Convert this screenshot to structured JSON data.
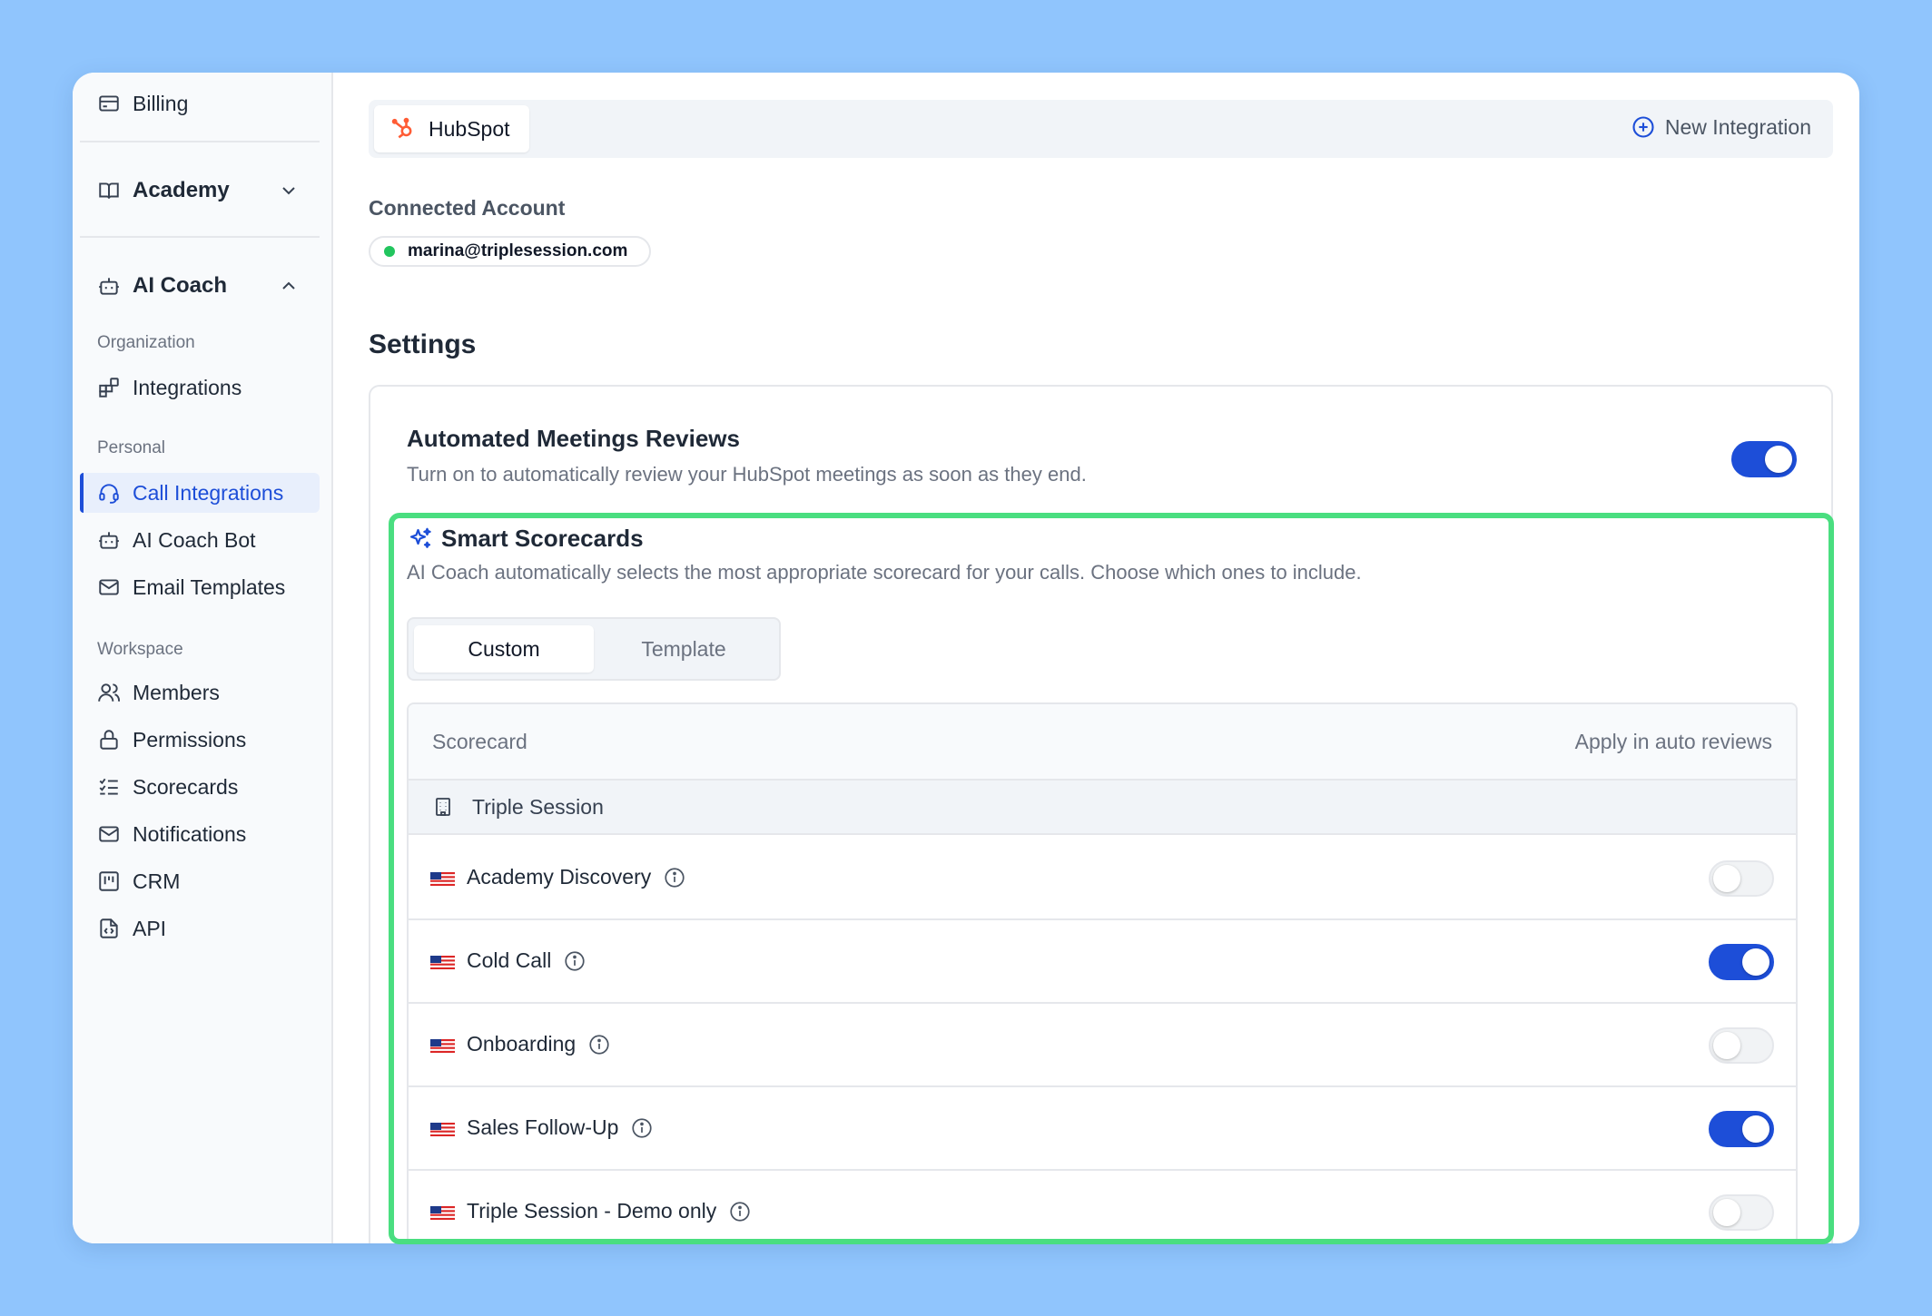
{
  "sidebar": {
    "billing": "Billing",
    "academy": "Academy",
    "ai_coach": "AI Coach",
    "sections": {
      "organization": "Organization",
      "personal": "Personal",
      "workspace": "Workspace"
    },
    "items": {
      "integrations": "Integrations",
      "call_integrations": "Call Integrations",
      "ai_coach_bot": "AI Coach Bot",
      "email_templates": "Email Templates",
      "members": "Members",
      "permissions": "Permissions",
      "scorecards": "Scorecards",
      "notifications": "Notifications",
      "crm": "CRM",
      "api": "API"
    },
    "active_item": "call_integrations"
  },
  "topbar": {
    "tab": "HubSpot",
    "new_integration": "New Integration"
  },
  "connected_account": {
    "label": "Connected Account",
    "email": "marina@triplesession.com",
    "status_color": "#22c55e"
  },
  "settings": {
    "title": "Settings",
    "automated_reviews": {
      "title": "Automated Meetings Reviews",
      "description": "Turn on to automatically review your HubSpot meetings as soon as they end.",
      "enabled": true
    },
    "smart_scorecards": {
      "title": "Smart Scorecards",
      "description": "AI Coach automatically selects the most appropriate scorecard for your calls. Choose which ones to include.",
      "tabs": [
        "Custom",
        "Template"
      ],
      "active_tab": "Custom",
      "table": {
        "col_scorecard": "Scorecard",
        "col_apply": "Apply in auto reviews",
        "group": "Triple Session",
        "rows": [
          {
            "name": "Academy Discovery",
            "enabled": false
          },
          {
            "name": "Cold Call",
            "enabled": true
          },
          {
            "name": "Onboarding",
            "enabled": false
          },
          {
            "name": "Sales Follow-Up",
            "enabled": true
          },
          {
            "name": "Triple Session - Demo only",
            "enabled": false
          }
        ]
      }
    }
  },
  "colors": {
    "accent": "#1d4ed8",
    "highlight": "#4ade80",
    "background": "#90c5fd",
    "hubspot": "#ff5c35"
  }
}
